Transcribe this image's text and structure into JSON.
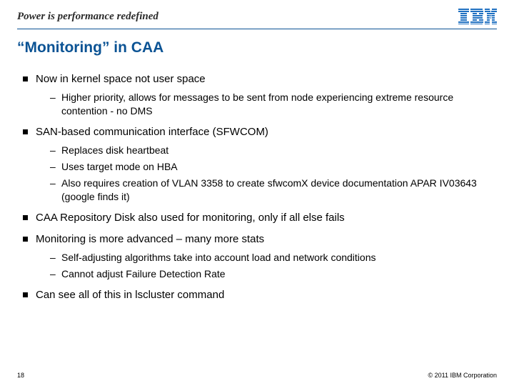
{
  "header": {
    "tagline": "Power is performance redefined",
    "logo_alt": "IBM"
  },
  "slide": {
    "title": "“Monitoring” in CAA"
  },
  "bullets": [
    {
      "text": "Now in kernel space not user space",
      "sub": [
        "Higher priority, allows for messages to be sent from node experiencing extreme resource contention - no DMS"
      ]
    },
    {
      "text": "SAN-based communication interface (SFWCOM)",
      "sub": [
        "Replaces disk heartbeat",
        "Uses target mode on HBA",
        "Also requires creation of VLAN 3358 to create sfwcomX device documentation APAR IV03643 (google finds it)"
      ]
    },
    {
      "text": "CAA Repository Disk also used for monitoring, only if all else fails",
      "sub": []
    },
    {
      "text": "Monitoring is more advanced – many more stats",
      "sub": [
        "Self-adjusting algorithms take into account load and network conditions",
        "Cannot adjust Failure Detection Rate"
      ]
    },
    {
      "text": "Can see all of this in lscluster command",
      "sub": []
    }
  ],
  "footer": {
    "page_number": "18",
    "copyright": "© 2011 IBM Corporation"
  }
}
